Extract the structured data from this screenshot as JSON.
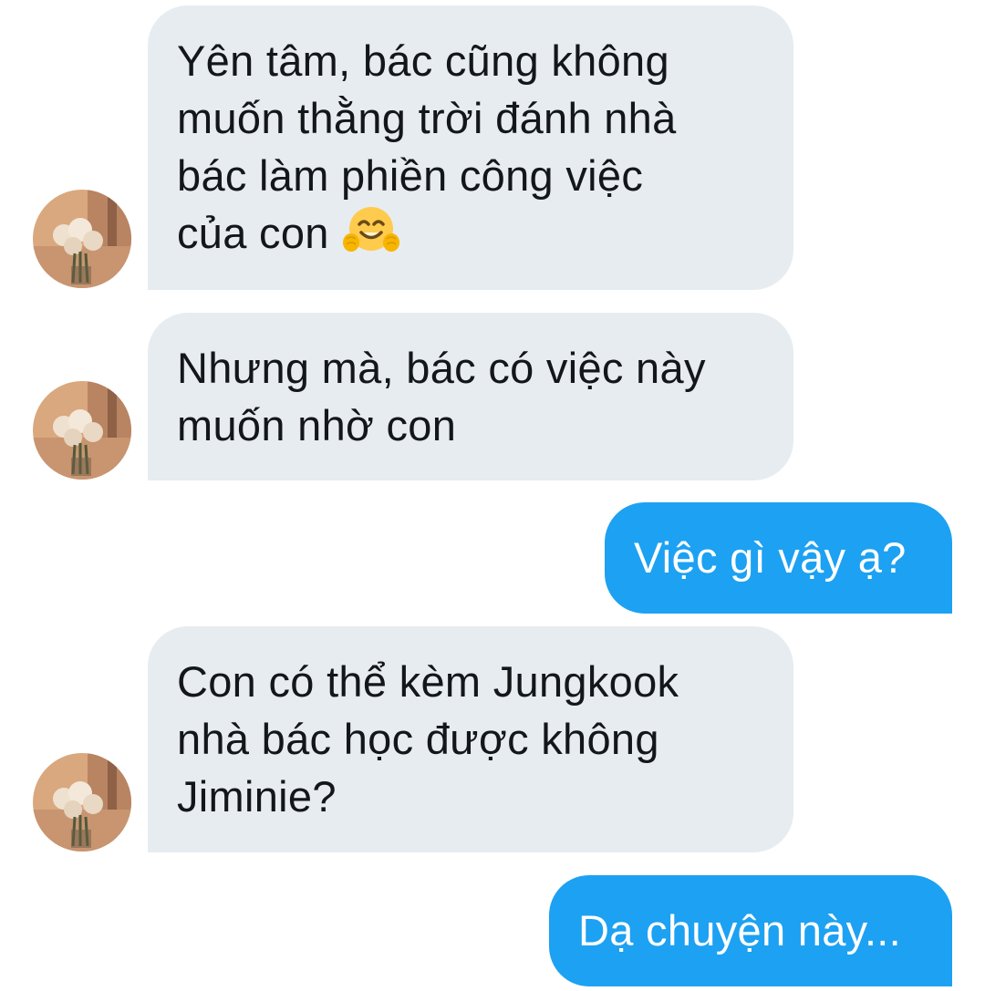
{
  "messages": [
    {
      "side": "incoming",
      "lines": [
        "Yên tâm, bác cũng không",
        "muốn thằng trời đánh nhà",
        "bác làm phiền công việc",
        "của con"
      ],
      "emoji": "hugging-face-icon"
    },
    {
      "side": "incoming",
      "lines": [
        "Nhưng mà, bác có việc này",
        "muốn nhờ con"
      ]
    },
    {
      "side": "outgoing",
      "lines": [
        "Việc gì vậy ạ?"
      ]
    },
    {
      "side": "incoming",
      "lines": [
        "Con có thể kèm Jungkook",
        "nhà bác học được không",
        "Jiminie?"
      ]
    },
    {
      "side": "outgoing",
      "lines": [
        "Dạ chuyện này..."
      ]
    }
  ],
  "colors": {
    "incoming_bubble": "#e6ecf0",
    "incoming_text": "#14171a",
    "outgoing_bubble": "#1da1f2",
    "outgoing_text": "#ffffff"
  },
  "avatar": {
    "icon": "flower-vase-avatar-icon"
  }
}
